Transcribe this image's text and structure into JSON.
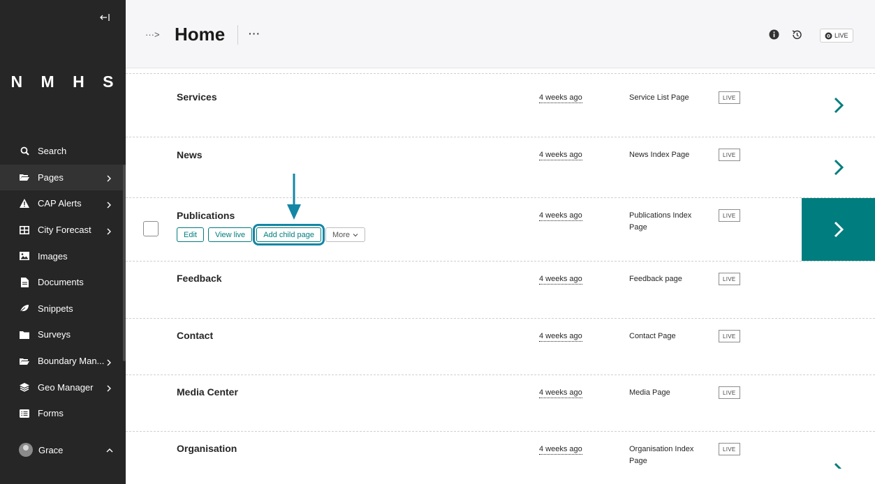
{
  "sidebar": {
    "logo": "N M H S",
    "items": [
      {
        "label": "Search",
        "icon": "search-icon",
        "has_submenu": false
      },
      {
        "label": "Pages",
        "icon": "folder-open-icon",
        "has_submenu": true
      },
      {
        "label": "CAP Alerts",
        "icon": "warning-icon",
        "has_submenu": true
      },
      {
        "label": "City Forecast",
        "icon": "table-icon",
        "has_submenu": true
      },
      {
        "label": "Images",
        "icon": "image-icon",
        "has_submenu": false
      },
      {
        "label": "Documents",
        "icon": "document-icon",
        "has_submenu": false
      },
      {
        "label": "Snippets",
        "icon": "leaf-icon",
        "has_submenu": false
      },
      {
        "label": "Surveys",
        "icon": "folder-icon",
        "has_submenu": false
      },
      {
        "label": "Boundary Man...",
        "icon": "folder-open-icon",
        "has_submenu": true
      },
      {
        "label": "Geo Manager",
        "icon": "layers-icon",
        "has_submenu": true
      },
      {
        "label": "Forms",
        "icon": "form-icon",
        "has_submenu": false
      }
    ],
    "user": {
      "name": "Grace"
    }
  },
  "header": {
    "breadcrumb_toggle": "···>",
    "title": "Home",
    "more": "···",
    "status_badge": "LIVE"
  },
  "rows": [
    {
      "title": "Services",
      "updated": "4 weeks ago",
      "type": "Service List Page",
      "status": "LIVE"
    },
    {
      "title": "News",
      "updated": "4 weeks ago",
      "type": "News Index Page",
      "status": "LIVE"
    },
    {
      "title": "Publications",
      "updated": "4 weeks ago",
      "type": "Publications Index Page",
      "status": "LIVE",
      "actions": {
        "edit": "Edit",
        "view_live": "View live",
        "add_child": "Add child page",
        "more": "More"
      }
    },
    {
      "title": "Feedback",
      "updated": "4 weeks ago",
      "type": "Feedback page",
      "status": "LIVE"
    },
    {
      "title": "Contact",
      "updated": "4 weeks ago",
      "type": "Contact Page",
      "status": "LIVE"
    },
    {
      "title": "Media Center",
      "updated": "4 weeks ago",
      "type": "Media Page",
      "status": "LIVE"
    },
    {
      "title": "Organisation",
      "updated": "4 weeks ago",
      "type": "Organisation Index Page",
      "status": "LIVE"
    }
  ],
  "colors": {
    "accent": "#007d7e",
    "sidebar_bg": "#262626",
    "annotation": "#1486a5"
  }
}
